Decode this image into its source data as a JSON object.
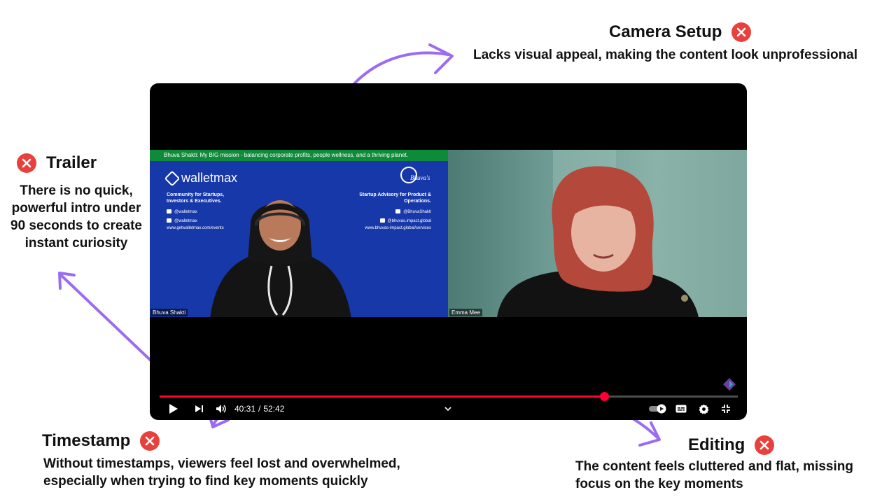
{
  "callouts": {
    "camera_setup": {
      "title": "Camera Setup",
      "description": "Lacks visual appeal, making the content look unprofessional"
    },
    "trailer": {
      "title": "Trailer",
      "description": "There is no quick, powerful intro under 90 seconds to create instant curiosity"
    },
    "timestamp": {
      "title": "Timestamp",
      "description": "Without timestamps, viewers feel lost and overwhelmed, especially when trying to find key moments quickly"
    },
    "editing": {
      "title": "Editing",
      "description": "The content feels cluttered and flat, missing focus on the key moments"
    }
  },
  "video": {
    "banner": "Bhuva Shakti: My BIG mission - balancing corporate profits, people wellness, and a thriving planet.",
    "left_panel": {
      "brand": "walletmax",
      "tagline": "Community for Startups, Investors & Executives.",
      "handles": [
        "@walletmax",
        "@walletmax"
      ],
      "url": "www.getwalletmax.com/events",
      "speaker": "Bhuva Shakti"
    },
    "right_panel_logo": {
      "brand": "Bhuva's",
      "tagline": "Startup Advisory for Product & Operations.",
      "handles": [
        "@BhuvaShakti",
        "@bhuvas.impact.global"
      ],
      "url": "www.bhuvas-impact.global/services"
    },
    "guest": {
      "speaker": "Emma Mee"
    },
    "player": {
      "current_time": "40:31",
      "separator": "/",
      "duration": "52:42",
      "progress_fraction": 0.769
    }
  },
  "colors": {
    "accent_red": "#e8413d",
    "annotation_purple": "#9b6cf0",
    "progress_red": "#ff0033",
    "slide_blue": "#1738a8",
    "banner_green": "#0d8a3a"
  },
  "icons": {
    "play": "play-icon",
    "next": "next-icon",
    "volume": "volume-icon",
    "chevron": "chevron-down-icon",
    "autoplay": "autoplay-toggle-icon",
    "captions": "captions-icon",
    "settings": "gear-icon",
    "exit_fullscreen": "exit-fullscreen-icon",
    "error": "close-circle-icon"
  }
}
